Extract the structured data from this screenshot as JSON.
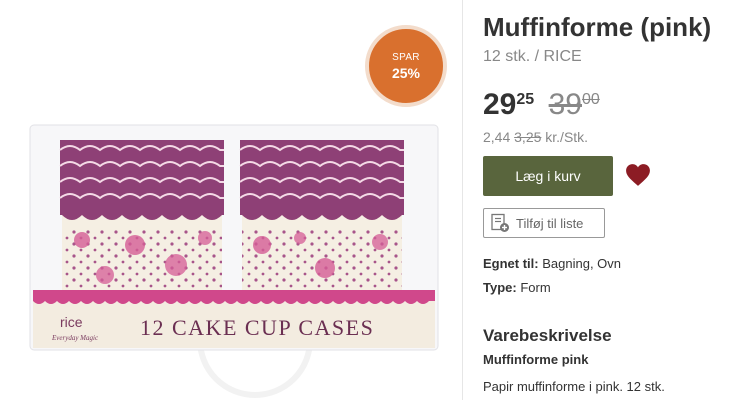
{
  "product": {
    "title": "Muffinforme (pink)",
    "subtitle": "12 stk. / RICE",
    "discount_badge": {
      "line1": "SPAR",
      "line2": "25%"
    },
    "price": {
      "whole": "29",
      "cents": "25",
      "old_whole": "39",
      "old_cents": "00"
    },
    "unit_price": {
      "current": "2,44",
      "old": "3,25",
      "unit": "kr./Stk."
    },
    "add_to_cart_label": "Læg i kurv",
    "add_to_list_label": "Tilføj til liste",
    "properties": [
      {
        "label": "Egnet til:",
        "value": "Bagning, Ovn"
      },
      {
        "label": "Type:",
        "value": "Form"
      }
    ],
    "description": {
      "heading": "Varebeskrivelse",
      "subheading": "Muffinforme pink",
      "text": "Papir muffinforme i pink. 12 stk."
    },
    "package": {
      "brand": "rice",
      "brand_tagline": "Everyday Magic",
      "label": "12 CAKE CUP CASES"
    }
  },
  "colors": {
    "accent_green": "#59653d",
    "badge_orange": "#d9702e",
    "heart": "#8c1c24",
    "cup_purple": "#8e4076",
    "cup_pink": "#d45c95",
    "cup_cream": "#f5efe3"
  },
  "icons": {
    "heart": "heart-icon",
    "list": "add-to-list-icon"
  }
}
